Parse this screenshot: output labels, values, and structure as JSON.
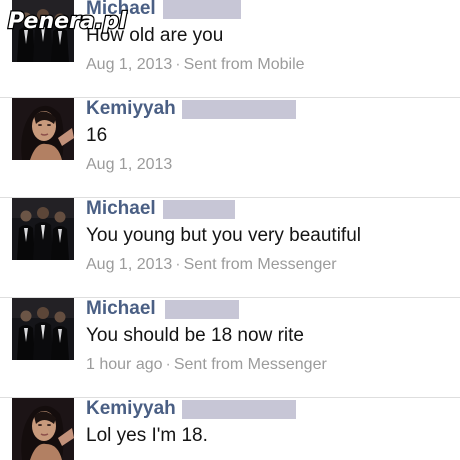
{
  "watermark": {
    "text": "Penera.pl"
  },
  "messages": [
    {
      "sender": "Michael",
      "avatar": "group-photo-avatar",
      "text": "How old are you",
      "time": "Aug 1, 2013",
      "source": "Sent from Mobile"
    },
    {
      "sender": "Kemiyyah",
      "avatar": "selfie-avatar",
      "text": "16",
      "time": "Aug 1, 2013",
      "source": ""
    },
    {
      "sender": "Michael",
      "avatar": "group-photo-avatar",
      "text": "You young but you very beautiful",
      "time": "Aug 1, 2013",
      "source": "Sent from Messenger"
    },
    {
      "sender": "Michael",
      "avatar": "group-photo-avatar",
      "text": "You should be 18 now rite",
      "time": "1 hour ago",
      "source": "Sent from Messenger"
    },
    {
      "sender": "Kemiyyah",
      "avatar": "selfie-avatar",
      "text": "Lol yes I'm 18.",
      "time": "",
      "source": ""
    }
  ],
  "colors": {
    "sender": "#4a5f84",
    "text": "#141414",
    "meta": "#9b9b9b",
    "redaction": "#c7c6d6",
    "divider": "#dedede"
  }
}
